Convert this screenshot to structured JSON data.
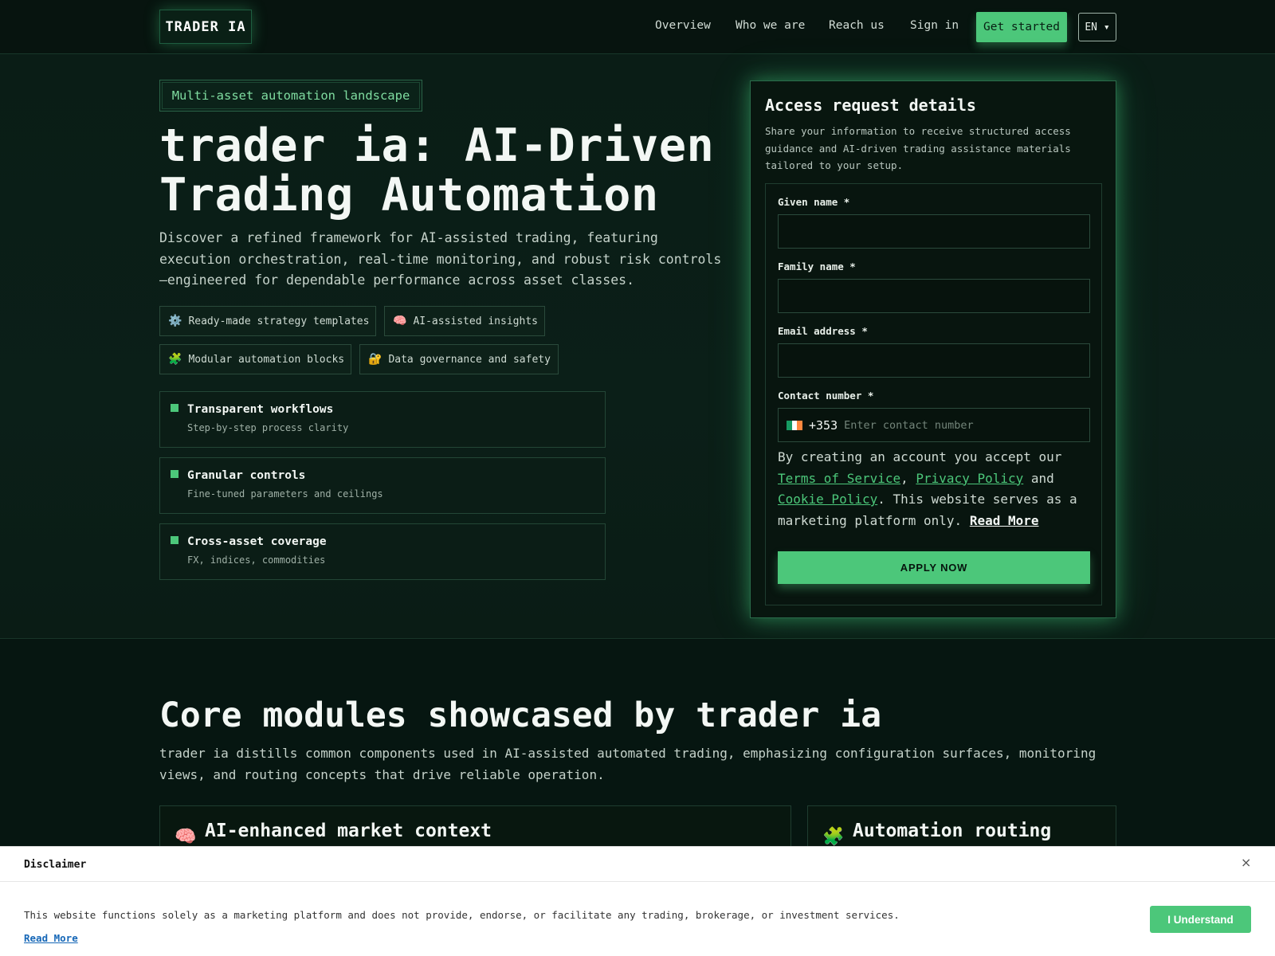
{
  "header": {
    "logo": "TRADER IA",
    "nav": [
      "Overview",
      "Who we are",
      "Reach us",
      "Sign in"
    ],
    "cta": "Get started",
    "language": "EN ▾"
  },
  "hero": {
    "tag": "Multi-asset automation landscape",
    "title": "trader ia: AI-Driven Trading Automation",
    "subtitle": "Discover a refined framework for AI-assisted trading, featuring execution orchestration, real-time monitoring, and robust risk controls—engineered for dependable performance across asset classes.",
    "chips": [
      {
        "icon": "⚙️",
        "label": "Ready-made strategy templates"
      },
      {
        "icon": "🧠",
        "label": "AI-assisted insights"
      },
      {
        "icon": "🧩",
        "label": "Modular automation blocks"
      },
      {
        "icon": "🔐",
        "label": "Data governance and safety"
      }
    ],
    "features": [
      {
        "title": "Transparent workflows",
        "desc": "Step-by-step process clarity"
      },
      {
        "title": "Granular controls",
        "desc": "Fine-tuned parameters and ceilings"
      },
      {
        "title": "Cross-asset coverage",
        "desc": "FX, indices, commodities"
      }
    ]
  },
  "form": {
    "title": "Access request details",
    "description": "Share your information to receive structured access guidance and AI-driven trading assistance materials tailored to your setup.",
    "fields": {
      "given_name": "Given name *",
      "family_name": "Family name *",
      "email": "Email address *",
      "contact": "Contact number *"
    },
    "phone_code": "+353",
    "phone_placeholder": "Enter contact number",
    "terms_prefix": "By creating an account you accept our",
    "terms_link": "Terms of Service",
    "privacy_link": "Privacy Policy",
    "terms_and": "and",
    "cookie_link": "Cookie Policy",
    "terms_suffix": ". This website serves as a marketing platform only.",
    "read_more": "Read More",
    "submit": "APPLY NOW"
  },
  "modules": {
    "title": "Core modules showcased by trader ia",
    "subtitle": "trader ia distills common components used in AI-assisted automated trading, emphasizing configuration surfaces, monitoring views, and routing concepts that drive reliable operation.",
    "cards": [
      {
        "icon": "🧠",
        "title": "AI-enhanced market context"
      },
      {
        "icon": "🧩",
        "title": "Automation routing"
      }
    ]
  },
  "disclaimer": {
    "title": "Disclaimer",
    "text": "This website functions solely as a marketing platform and does not provide, endorse, or facilitate any trading, brokerage, or investment services.",
    "read_more": "Read More",
    "button": "I Understand",
    "close": "×"
  },
  "colors": {
    "accent": "#4cc77a",
    "background": "#06140f",
    "link": "#1667b7"
  }
}
